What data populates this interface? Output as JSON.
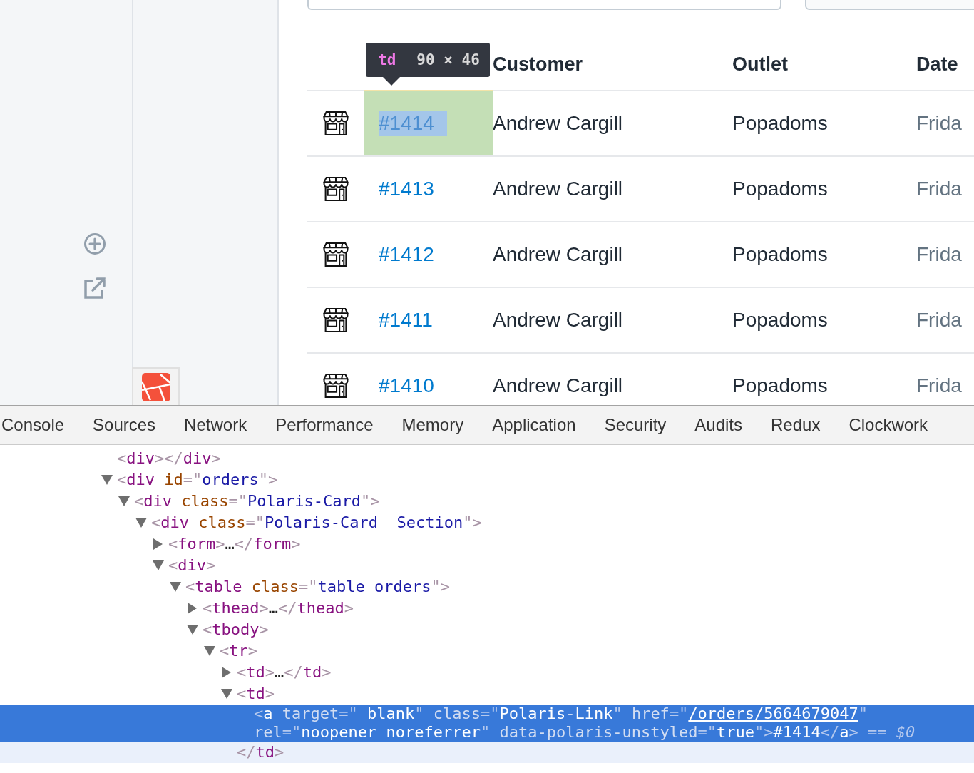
{
  "table": {
    "columns": [
      "Customer",
      "Outlet",
      "Date"
    ],
    "rows": [
      {
        "id": "#1414",
        "customer": "Andrew Cargill",
        "outlet": "Popadoms",
        "date": "Frida",
        "inspected": true
      },
      {
        "id": "#1413",
        "customer": "Andrew Cargill",
        "outlet": "Popadoms",
        "date": "Frida",
        "inspected": false
      },
      {
        "id": "#1412",
        "customer": "Andrew Cargill",
        "outlet": "Popadoms",
        "date": "Frida",
        "inspected": false
      },
      {
        "id": "#1411",
        "customer": "Andrew Cargill",
        "outlet": "Popadoms",
        "date": "Frida",
        "inspected": false
      },
      {
        "id": "#1410",
        "customer": "Andrew Cargill",
        "outlet": "Popadoms",
        "date": "Frida",
        "inspected": false
      }
    ]
  },
  "inspect_tooltip": {
    "tag": "td",
    "size": "90 × 46"
  },
  "devtools": {
    "tabs": [
      "Console",
      "Sources",
      "Network",
      "Performance",
      "Memory",
      "Application",
      "Security",
      "Audits",
      "Redux",
      "Clockwork"
    ],
    "tree": [
      {
        "tokens": [
          {
            "kind": "punct",
            "text": "<"
          },
          {
            "kind": "tag",
            "text": "div"
          },
          {
            "kind": "punct",
            "text": "></"
          },
          {
            "kind": "tag",
            "text": "div"
          },
          {
            "kind": "punct",
            "text": ">"
          }
        ]
      },
      {
        "expanded": true,
        "tokens": [
          {
            "kind": "punct",
            "text": "<"
          },
          {
            "kind": "tag",
            "text": "div"
          },
          {
            "kind": "attr",
            "text": " id"
          },
          {
            "kind": "punct",
            "text": "=\""
          },
          {
            "kind": "value",
            "text": "orders"
          },
          {
            "kind": "punct",
            "text": "\">"
          }
        ],
        "children": [
          {
            "expanded": true,
            "tokens": [
              {
                "kind": "punct",
                "text": "<"
              },
              {
                "kind": "tag",
                "text": "div"
              },
              {
                "kind": "attr",
                "text": " class"
              },
              {
                "kind": "punct",
                "text": "=\""
              },
              {
                "kind": "value",
                "text": "Polaris-Card"
              },
              {
                "kind": "punct",
                "text": "\">"
              }
            ],
            "children": [
              {
                "expanded": true,
                "tokens": [
                  {
                    "kind": "punct",
                    "text": "<"
                  },
                  {
                    "kind": "tag",
                    "text": "div"
                  },
                  {
                    "kind": "attr",
                    "text": " class"
                  },
                  {
                    "kind": "punct",
                    "text": "=\""
                  },
                  {
                    "kind": "value",
                    "text": "Polaris-Card__Section"
                  },
                  {
                    "kind": "punct",
                    "text": "\">"
                  }
                ],
                "children": [
                  {
                    "expanded": false,
                    "tokens": [
                      {
                        "kind": "punct",
                        "text": "<"
                      },
                      {
                        "kind": "tag",
                        "text": "form"
                      },
                      {
                        "kind": "punct",
                        "text": ">"
                      },
                      {
                        "kind": "text",
                        "text": "…"
                      },
                      {
                        "kind": "punct",
                        "text": "</"
                      },
                      {
                        "kind": "tag",
                        "text": "form"
                      },
                      {
                        "kind": "punct",
                        "text": ">"
                      }
                    ]
                  },
                  {
                    "expanded": true,
                    "tokens": [
                      {
                        "kind": "punct",
                        "text": "<"
                      },
                      {
                        "kind": "tag",
                        "text": "div"
                      },
                      {
                        "kind": "punct",
                        "text": ">"
                      }
                    ],
                    "children": [
                      {
                        "expanded": true,
                        "tokens": [
                          {
                            "kind": "punct",
                            "text": "<"
                          },
                          {
                            "kind": "tag",
                            "text": "table"
                          },
                          {
                            "kind": "attr",
                            "text": " class"
                          },
                          {
                            "kind": "punct",
                            "text": "=\""
                          },
                          {
                            "kind": "value",
                            "text": "table orders"
                          },
                          {
                            "kind": "punct",
                            "text": "\">"
                          }
                        ],
                        "children": [
                          {
                            "expanded": false,
                            "tokens": [
                              {
                                "kind": "punct",
                                "text": "<"
                              },
                              {
                                "kind": "tag",
                                "text": "thead"
                              },
                              {
                                "kind": "punct",
                                "text": ">"
                              },
                              {
                                "kind": "text",
                                "text": "…"
                              },
                              {
                                "kind": "punct",
                                "text": "</"
                              },
                              {
                                "kind": "tag",
                                "text": "thead"
                              },
                              {
                                "kind": "punct",
                                "text": ">"
                              }
                            ]
                          },
                          {
                            "expanded": true,
                            "tokens": [
                              {
                                "kind": "punct",
                                "text": "<"
                              },
                              {
                                "kind": "tag",
                                "text": "tbody"
                              },
                              {
                                "kind": "punct",
                                "text": ">"
                              }
                            ],
                            "children": [
                              {
                                "expanded": true,
                                "tokens": [
                                  {
                                    "kind": "punct",
                                    "text": "<"
                                  },
                                  {
                                    "kind": "tag",
                                    "text": "tr"
                                  },
                                  {
                                    "kind": "punct",
                                    "text": ">"
                                  }
                                ],
                                "children": [
                                  {
                                    "expanded": false,
                                    "tokens": [
                                      {
                                        "kind": "punct",
                                        "text": "<"
                                      },
                                      {
                                        "kind": "tag",
                                        "text": "td"
                                      },
                                      {
                                        "kind": "punct",
                                        "text": ">"
                                      },
                                      {
                                        "kind": "text",
                                        "text": "…"
                                      },
                                      {
                                        "kind": "punct",
                                        "text": "</"
                                      },
                                      {
                                        "kind": "tag",
                                        "text": "td"
                                      },
                                      {
                                        "kind": "punct",
                                        "text": ">"
                                      }
                                    ]
                                  },
                                  {
                                    "expanded": true,
                                    "tokens": [
                                      {
                                        "kind": "punct",
                                        "text": "<"
                                      },
                                      {
                                        "kind": "tag",
                                        "text": "td"
                                      },
                                      {
                                        "kind": "punct",
                                        "text": ">"
                                      }
                                    ],
                                    "children": [
                                      {
                                        "selected": true,
                                        "tokens": [
                                          {
                                            "kind": "punct",
                                            "text": "<"
                                          },
                                          {
                                            "kind": "tag",
                                            "text": "a"
                                          },
                                          {
                                            "kind": "attr",
                                            "text": " target"
                                          },
                                          {
                                            "kind": "punct",
                                            "text": "=\""
                                          },
                                          {
                                            "kind": "value",
                                            "text": "_blank"
                                          },
                                          {
                                            "kind": "punct",
                                            "text": "\""
                                          },
                                          {
                                            "kind": "attr",
                                            "text": " class"
                                          },
                                          {
                                            "kind": "punct",
                                            "text": "=\""
                                          },
                                          {
                                            "kind": "value",
                                            "text": "Polaris-Link"
                                          },
                                          {
                                            "kind": "punct",
                                            "text": "\""
                                          },
                                          {
                                            "kind": "attr",
                                            "text": " href"
                                          },
                                          {
                                            "kind": "punct",
                                            "text": "=\""
                                          },
                                          {
                                            "kind": "link",
                                            "text": "/orders/5664679047"
                                          },
                                          {
                                            "kind": "punct",
                                            "text": "\""
                                          },
                                          {
                                            "kind": "attr",
                                            "text": " rel"
                                          },
                                          {
                                            "kind": "punct",
                                            "text": "=\""
                                          },
                                          {
                                            "kind": "value",
                                            "text": "noopener noreferrer"
                                          },
                                          {
                                            "kind": "punct",
                                            "text": "\""
                                          },
                                          {
                                            "kind": "attr",
                                            "text": " data-polaris-unstyled"
                                          },
                                          {
                                            "kind": "punct",
                                            "text": "=\""
                                          },
                                          {
                                            "kind": "value",
                                            "text": "true"
                                          },
                                          {
                                            "kind": "punct",
                                            "text": "\">"
                                          },
                                          {
                                            "kind": "text",
                                            "text": "#1414"
                                          },
                                          {
                                            "kind": "punct",
                                            "text": "</"
                                          },
                                          {
                                            "kind": "tag",
                                            "text": "a"
                                          },
                                          {
                                            "kind": "punct",
                                            "text": ">"
                                          },
                                          {
                                            "kind": "ref",
                                            "text": " == $0"
                                          }
                                        ]
                                      }
                                    ],
                                    "closing": {
                                      "hovered": true,
                                      "tokens": [
                                        {
                                          "kind": "punct",
                                          "text": "</"
                                        },
                                        {
                                          "kind": "tag",
                                          "text": "td"
                                        },
                                        {
                                          "kind": "punct",
                                          "text": ">"
                                        }
                                      ]
                                    }
                                  }
                                ]
                              }
                            ]
                          }
                        ]
                      }
                    ]
                  }
                ]
              }
            ]
          }
        ]
      }
    ]
  }
}
